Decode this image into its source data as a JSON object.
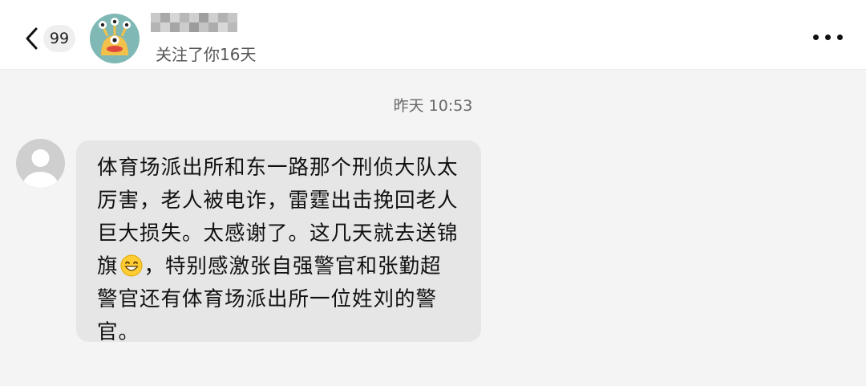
{
  "header": {
    "unread_count": "99",
    "follow_text": "关注了你16天",
    "icons": {
      "back": "chevron-left-icon",
      "more": "more-horizontal-icon"
    }
  },
  "chat": {
    "timestamp": "昨天 10:53",
    "message": {
      "text_before_emoji": "体育场派出所和东一路那个刑侦大队太厉害，老人被电诈，雷霆出击挽回老人巨大损失。太感谢了。这几天就去送锦旗",
      "emoji": "grinning-face-emoji",
      "text_after_emoji": "，特别感激张自强警官和张勤超警官还有体育场派出所一位姓刘的警官。"
    }
  },
  "colors": {
    "background": "#f4f4f4",
    "header_bg": "#ffffff",
    "bubble_bg": "#e6e6e6",
    "avatar_teal": "#7fb8b4",
    "avatar_yellow": "#f2c14a"
  }
}
